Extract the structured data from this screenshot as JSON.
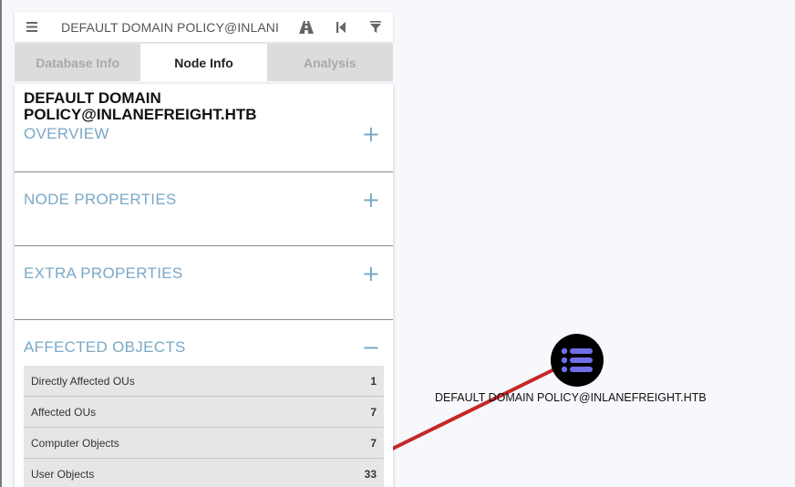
{
  "search": {
    "value": "DEFAULT DOMAIN POLICY@INLANI"
  },
  "toolbar": {
    "menu_icon": "hamburger-icon",
    "pathfinding_icon": "road-icon",
    "back_icon": "back-icon",
    "filter_icon": "filter-icon"
  },
  "tabs": [
    {
      "label": "Database Info",
      "active": false
    },
    {
      "label": "Node Info",
      "active": true
    },
    {
      "label": "Analysis",
      "active": false
    }
  ],
  "node": {
    "title": "DEFAULT DOMAIN POLICY@INLANEFREIGHT.HTB"
  },
  "sections": {
    "overview": {
      "label": "OVERVIEW",
      "toggle": "+"
    },
    "node_properties": {
      "label": "NODE PROPERTIES",
      "toggle": "+"
    },
    "extra_properties": {
      "label": "EXTRA PROPERTIES",
      "toggle": "+"
    },
    "affected_objects": {
      "label": "AFFECTED OBJECTS",
      "toggle": "−",
      "rows": [
        {
          "label": "Directly Affected OUs",
          "value": "1"
        },
        {
          "label": "Affected OUs",
          "value": "7"
        },
        {
          "label": "Computer Objects",
          "value": "7"
        },
        {
          "label": "User Objects",
          "value": "33"
        }
      ]
    }
  },
  "graph": {
    "node_label": "DEFAULT DOMAIN POLICY@INLANEFREIGHT.HTB",
    "node_icon": "list-icon",
    "edge_color": "#c62828",
    "node_color": "#000000",
    "icon_color": "#6f6fe8"
  }
}
